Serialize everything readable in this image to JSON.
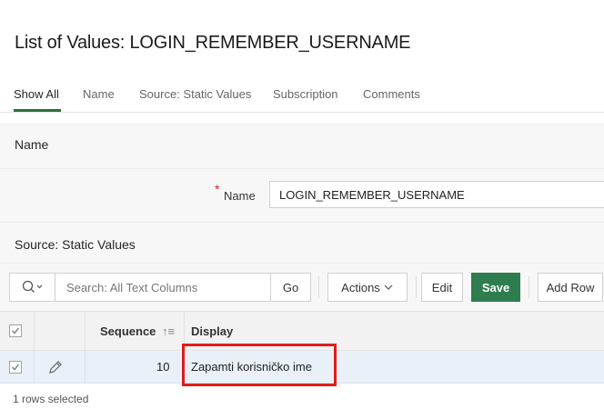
{
  "page": {
    "title": "List of Values: LOGIN_REMEMBER_USERNAME"
  },
  "tabs": [
    {
      "label": "Show All"
    },
    {
      "label": "Name"
    },
    {
      "label": "Source: Static Values"
    },
    {
      "label": "Subscription"
    },
    {
      "label": "Comments"
    }
  ],
  "name_section": {
    "title": "Name",
    "required_marker": "*",
    "label": "Name",
    "value": "LOGIN_REMEMBER_USERNAME"
  },
  "source_section": {
    "title": "Source: Static Values"
  },
  "toolbar": {
    "search_placeholder": "Search: All Text Columns",
    "go_label": "Go",
    "actions_label": "Actions",
    "edit_label": "Edit",
    "save_label": "Save",
    "add_row_label": "Add Row"
  },
  "grid": {
    "columns": [
      {
        "label": "Sequence",
        "sort_indicator": "↑≡"
      },
      {
        "label": "Display"
      }
    ],
    "rows": [
      {
        "sequence": "10",
        "display": "Zapamti korisničko ime",
        "selected": true
      }
    ]
  },
  "footer": {
    "status": "1 rows selected"
  },
  "colors": {
    "accent": "#2e7d4f",
    "highlight": "#e41b1b",
    "selected_row": "#e9f0f8"
  },
  "icons": [
    "search-icon",
    "chevron-down-icon",
    "check-icon",
    "pencil-icon"
  ]
}
